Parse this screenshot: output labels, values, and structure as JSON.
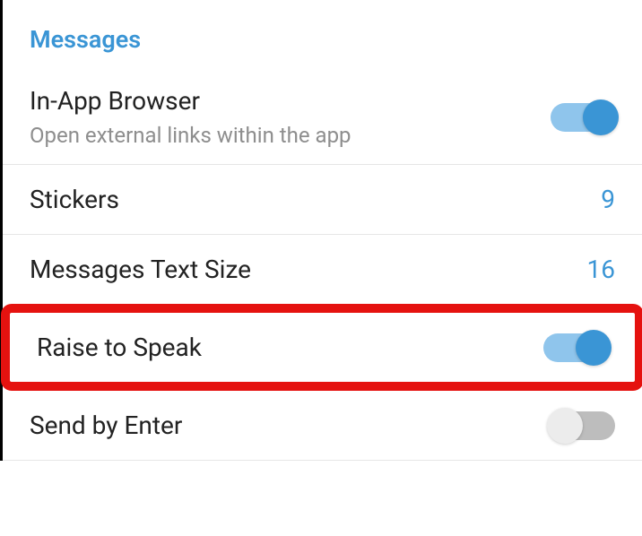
{
  "section": {
    "header": "Messages"
  },
  "settings": {
    "inAppBrowser": {
      "title": "In-App Browser",
      "subtitle": "Open external links within the app",
      "enabled": true
    },
    "stickers": {
      "title": "Stickers",
      "value": "9"
    },
    "textSize": {
      "title": "Messages Text Size",
      "value": "16"
    },
    "raiseToSpeak": {
      "title": "Raise to Speak",
      "enabled": true
    },
    "sendByEnter": {
      "title": "Send by Enter",
      "enabled": false
    }
  }
}
